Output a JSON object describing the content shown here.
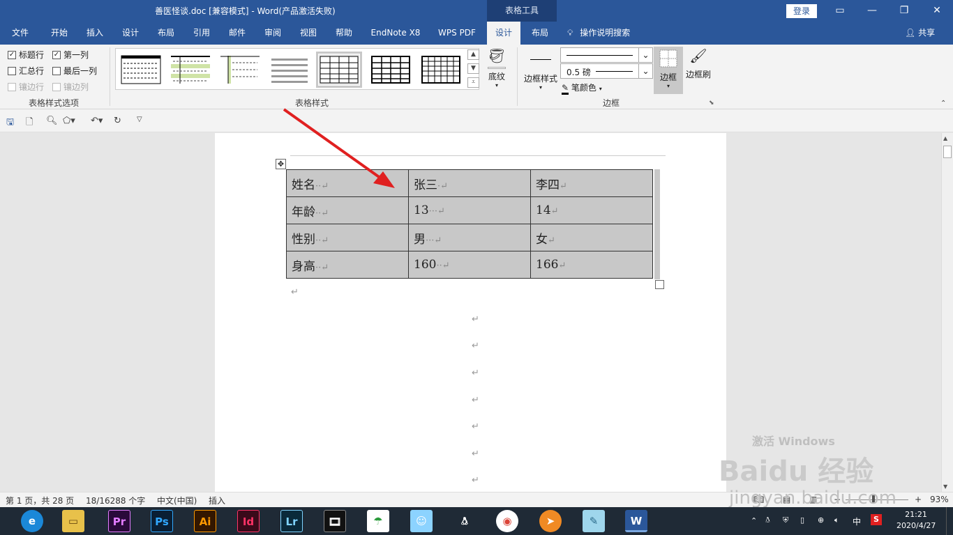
{
  "window": {
    "title": "善医怪谈.doc [兼容模式]  -  Word(产品激活失败)",
    "table_tools": "表格工具",
    "login": "登录"
  },
  "tabs": [
    "文件",
    "开始",
    "插入",
    "设计",
    "布局",
    "引用",
    "邮件",
    "审阅",
    "视图",
    "帮助",
    "EndNote X8",
    "WPS PDF",
    "设计",
    "布局"
  ],
  "search_label": "操作说明搜索",
  "share_label": "共享",
  "ribbon": {
    "options": {
      "header_row": "标题行",
      "first_col": "第一列",
      "total_row": "汇总行",
      "last_col": "最后一列",
      "banded_rows": "镶边行",
      "banded_cols": "镶边列",
      "group": "表格样式选项"
    },
    "styles_group": "表格样式",
    "shading": "底纹",
    "border_styles": "边框样式",
    "line_weight": "0.5 磅",
    "pen_color": "笔颜色",
    "borders": "边框",
    "border_painter": "边框刷",
    "borders_group": "边框"
  },
  "table": {
    "rows": [
      [
        "姓名",
        "张三",
        "李四"
      ],
      [
        "年龄",
        "13",
        "14"
      ],
      [
        "性别",
        "男",
        "女"
      ],
      [
        "身高",
        "160",
        "166"
      ]
    ]
  },
  "status": {
    "page": "第 1 页，共 28 页",
    "words": "18/16288 个字",
    "lang": "中文(中国)",
    "mode": "插入",
    "zoom": "93%"
  },
  "taskbar": {
    "apps": [
      "Pr",
      "Ps",
      "Ai",
      "Id",
      "Lr"
    ],
    "ime": "中",
    "time": "21:21",
    "date": "2020/4/27"
  },
  "watermark": {
    "line1": "激活 Windows",
    "brand": "Baidu 经验",
    "url": "jingyan.baidu.com"
  },
  "colors": {
    "accent": "#2b579a",
    "arrow": "#e02020"
  }
}
